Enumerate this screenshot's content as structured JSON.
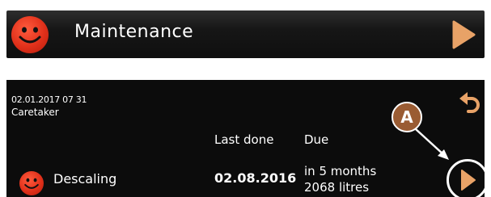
{
  "header": {
    "title": "Maintenance",
    "status_icon": "smiley-face-icon",
    "next_icon": "play-arrow-icon"
  },
  "panel": {
    "datetime": "02.01.2017 07 31",
    "role": "Caretaker",
    "back_icon": "undo-arrow-icon",
    "columns": {
      "last_done": "Last done",
      "due": "Due"
    },
    "rows": [
      {
        "label": "Descaling",
        "last_done": "02.08.2016",
        "due_line1": "in 5 months",
        "due_line2": "2068 litres",
        "status_icon": "smiley-face-icon",
        "action_icon": "play-arrow-icon"
      }
    ]
  },
  "callout": {
    "label": "A"
  },
  "colors": {
    "accent_orange": "#e8a267",
    "status_red": "#e0301a",
    "callout_brown": "#9a5c33",
    "panel_bg": "#0c0c0c"
  }
}
